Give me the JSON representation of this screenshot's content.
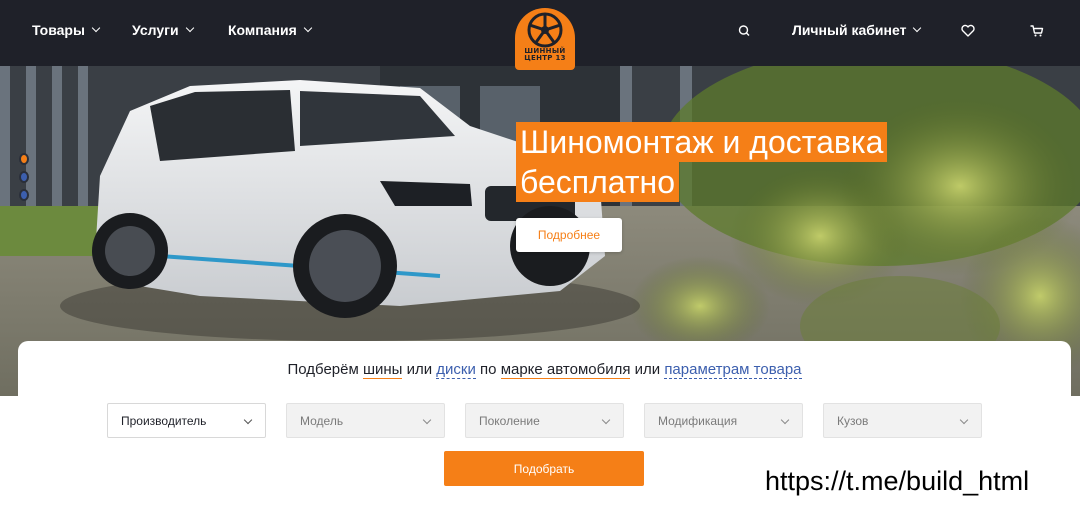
{
  "header": {
    "nav": [
      {
        "label": "Товары"
      },
      {
        "label": "Услуги"
      },
      {
        "label": "Компания"
      }
    ],
    "logo_text_line1": "ШИННЫЙ",
    "logo_text_line2": "ЦЕНТР 13",
    "account_label": "Личный кабинет",
    "icons": [
      "search-icon",
      "heart-icon",
      "cart-icon"
    ]
  },
  "hero": {
    "title_line1": "Шиномонтаж и доставка",
    "title_line2": "бесплатно",
    "more_label": "Подробнее",
    "slides": 3,
    "active_slide": 1
  },
  "selector": {
    "headline": {
      "p1": "Подберём ",
      "tires": "шины",
      "p2": " или ",
      "wheels": "диски",
      "p3": " по ",
      "by_car": "марке автомобиля",
      "p4": " или ",
      "by_params": "параметрам товара"
    },
    "fields": [
      {
        "label": "Производитель",
        "enabled": true
      },
      {
        "label": "Модель",
        "enabled": false
      },
      {
        "label": "Поколение",
        "enabled": false
      },
      {
        "label": "Модификация",
        "enabled": false
      },
      {
        "label": "Кузов",
        "enabled": false
      }
    ],
    "submit_label": "Подобрать"
  },
  "watermark": "https://t.me/build_html",
  "colors": {
    "accent": "#f57f17",
    "header_bg": "#1f2129",
    "link_blue": "#3c5fae"
  }
}
